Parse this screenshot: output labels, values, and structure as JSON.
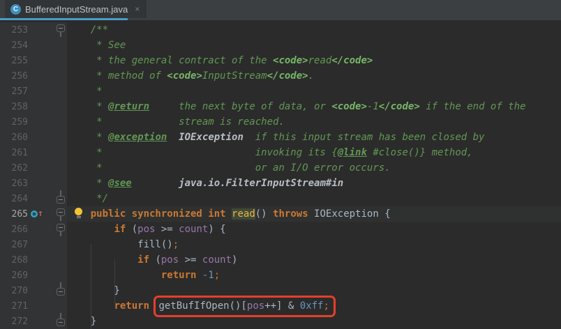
{
  "tab": {
    "title": "BufferedInputStream.java",
    "close_glyph": "×",
    "icon_letter": "C",
    "underline_color": "#4a9cc8"
  },
  "colors": {
    "editor_bg": "#2b2b2b",
    "gutter_bg": "#313335",
    "tabbar_bg": "#3c3f41",
    "keyword": "#cc7832",
    "comment": "#629755",
    "field": "#9876aa",
    "number_literal": "#6897bb",
    "plain": "#a9b7c6",
    "annotation_box": "#e4402a",
    "line_number": "#606366"
  },
  "editor": {
    "current_line": 265,
    "lines": [
      {
        "n": 253,
        "fold": "start",
        "seg": [
          [
            "doc",
            "    /**"
          ]
        ]
      },
      {
        "n": 254,
        "seg": [
          [
            "doc",
            "     * See"
          ]
        ]
      },
      {
        "n": 255,
        "seg": [
          [
            "doc",
            "     * the general contract of the "
          ],
          [
            "mk",
            "<code>"
          ],
          [
            "doc",
            "read"
          ],
          [
            "mk",
            "</code>"
          ]
        ]
      },
      {
        "n": 256,
        "seg": [
          [
            "doc",
            "     * method of "
          ],
          [
            "mk",
            "<code>"
          ],
          [
            "doc",
            "InputStream"
          ],
          [
            "mk",
            "</code>"
          ],
          [
            "doc",
            "."
          ]
        ]
      },
      {
        "n": 257,
        "seg": [
          [
            "doc",
            "     *"
          ]
        ]
      },
      {
        "n": 258,
        "seg": [
          [
            "doc",
            "     * "
          ],
          [
            "tag",
            "@return"
          ],
          [
            "doc",
            "     the next byte of data, or "
          ],
          [
            "mk",
            "<code>"
          ],
          [
            "doc",
            "-1"
          ],
          [
            "mk",
            "</code>"
          ],
          [
            "doc",
            " if the end of the"
          ]
        ]
      },
      {
        "n": 259,
        "seg": [
          [
            "doc",
            "     *             stream is reached."
          ]
        ]
      },
      {
        "n": 260,
        "seg": [
          [
            "doc",
            "     * "
          ],
          [
            "tag",
            "@exception"
          ],
          [
            "doc",
            "  "
          ],
          [
            "val",
            "IOException"
          ],
          [
            "doc",
            "  if this input stream has been closed by"
          ]
        ]
      },
      {
        "n": 261,
        "seg": [
          [
            "doc",
            "     *                          invoking its {"
          ],
          [
            "tag",
            "@link"
          ],
          [
            "doc",
            " #close()} method,"
          ]
        ]
      },
      {
        "n": 262,
        "seg": [
          [
            "doc",
            "     *                          or an I/O error occurs."
          ]
        ]
      },
      {
        "n": 263,
        "seg": [
          [
            "doc",
            "     * "
          ],
          [
            "tag",
            "@see"
          ],
          [
            "doc",
            "        "
          ],
          [
            "val",
            "java.io.FilterInputStream#in"
          ]
        ]
      },
      {
        "n": 264,
        "fold": "end",
        "seg": [
          [
            "doc",
            "     */"
          ]
        ]
      },
      {
        "n": 265,
        "fold": "start",
        "icon": "overrides",
        "bulb": true,
        "seg": [
          [
            "pl",
            "    "
          ],
          [
            "kw",
            "public synchronized int"
          ],
          [
            "pl",
            " "
          ],
          [
            "md",
            "read"
          ],
          [
            "pl",
            "() "
          ],
          [
            "kw",
            "throws"
          ],
          [
            "pl",
            " IOException {"
          ]
        ]
      },
      {
        "n": 266,
        "fold": "start",
        "seg": [
          [
            "pl",
            "        "
          ],
          [
            "kw",
            "if"
          ],
          [
            "pl",
            " ("
          ],
          [
            "fld",
            "pos"
          ],
          [
            "pl",
            " >= "
          ],
          [
            "fld",
            "count"
          ],
          [
            "pl",
            ") {"
          ]
        ]
      },
      {
        "n": 267,
        "seg": [
          [
            "pl",
            "            fill()"
          ],
          [
            "sc",
            ";"
          ]
        ]
      },
      {
        "n": 268,
        "seg": [
          [
            "pl",
            "            "
          ],
          [
            "kw",
            "if"
          ],
          [
            "pl",
            " ("
          ],
          [
            "fld",
            "pos"
          ],
          [
            "pl",
            " >= "
          ],
          [
            "fld",
            "count"
          ],
          [
            "pl",
            ")"
          ]
        ]
      },
      {
        "n": 269,
        "seg": [
          [
            "pl",
            "                "
          ],
          [
            "kw",
            "return"
          ],
          [
            "pl",
            " "
          ],
          [
            "num",
            "-1"
          ],
          [
            "sc",
            ";"
          ]
        ]
      },
      {
        "n": 270,
        "fold": "end",
        "seg": [
          [
            "pl",
            "        }"
          ]
        ]
      },
      {
        "n": 271,
        "seg": [
          [
            "pl",
            "        "
          ],
          [
            "kw",
            "return"
          ],
          [
            "pl",
            " "
          ],
          [
            "pl",
            "getBufIfOpen()[",
            "x"
          ],
          [
            "fld",
            "pos",
            "x"
          ],
          [
            "pl",
            "++] & ",
            "x"
          ],
          [
            "num",
            "0xff",
            "x"
          ],
          [
            "sc",
            ";",
            "x"
          ]
        ]
      },
      {
        "n": 272,
        "fold": "end",
        "seg": [
          [
            "pl",
            "    }"
          ]
        ]
      }
    ]
  }
}
